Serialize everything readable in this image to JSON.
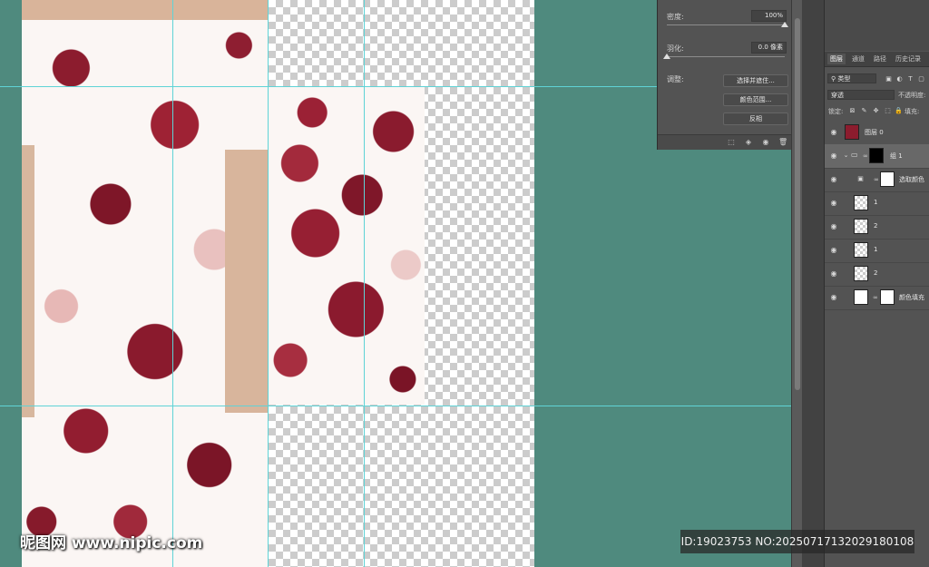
{
  "mask_properties": {
    "density_label": "密度:",
    "density_value": "100%",
    "feather_label": "羽化:",
    "feather_value": "0.0 像素",
    "adjust_label": "调整:",
    "select_and_mask_button": "选择并遮住...",
    "color_range_button": "颜色范围...",
    "invert_button": "反相",
    "density_level": 1.0,
    "feather_level": 0.0
  },
  "layers_panel": {
    "tabs": [
      "图层",
      "通道",
      "路径",
      "历史记录"
    ],
    "filter_kind": "类型",
    "blend_mode": "穿透",
    "opacity_label": "不透明度:",
    "lock_label": "锁定:",
    "fill_label": "填充:",
    "layers": [
      {
        "name": "图层 0"
      },
      {
        "name": "组 1"
      },
      {
        "name": "选取颜色"
      },
      {
        "name": "1"
      },
      {
        "name": "2"
      },
      {
        "name": "1"
      },
      {
        "name": "2"
      },
      {
        "name": "颜色填充"
      }
    ]
  },
  "watermark": {
    "logo_text": "昵图网 www.nipic.com",
    "id_text": "ID:19023753 NO:20250717132029180108"
  },
  "colors": {
    "canvas_background": "#4f8a7e",
    "guide": "#5fd3d6",
    "panel": "#535353",
    "floral_red": "#8c1c2e",
    "floral_pink": "#e9c1bf"
  }
}
